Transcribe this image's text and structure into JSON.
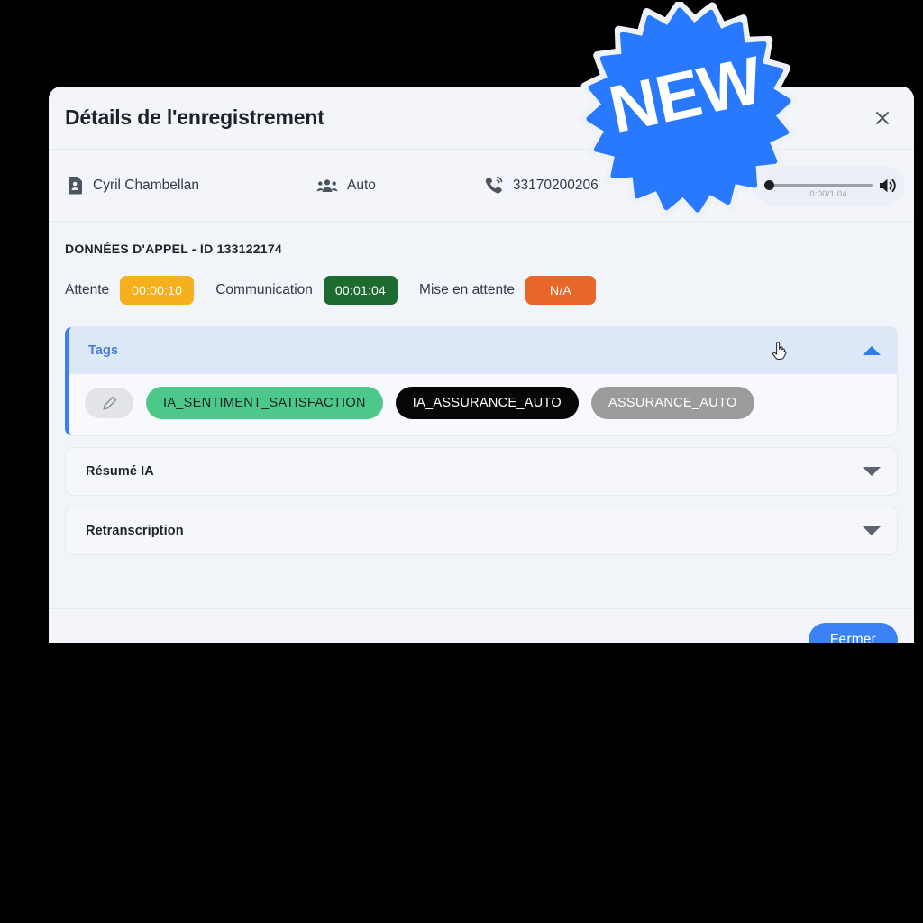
{
  "modal": {
    "title": "Détails de l'enregistrement",
    "close_icon": "close-icon"
  },
  "info_bar": {
    "agent": {
      "icon": "contact-card-icon",
      "label": "Cyril Chambellan"
    },
    "queue": {
      "icon": "group-people-icon",
      "label": "Auto"
    },
    "phone": {
      "icon": "phone-ring-icon",
      "label": "33170200206"
    },
    "audio": {
      "time": "0:00/1:04",
      "progress_percent": 0,
      "volume_icon": "volume-on-icon"
    }
  },
  "call_data": {
    "section_title": "DONNÉES D'APPEL - ID 133122174",
    "metrics": [
      {
        "label": "Attente",
        "value": "00:00:10",
        "color": "#f6b01e"
      },
      {
        "label": "Communication",
        "value": "00:01:04",
        "color": "#1d6b30"
      },
      {
        "label": "Mise en attente",
        "value": "N/A",
        "color": "#e8662a"
      }
    ]
  },
  "accordions": [
    {
      "title": "Tags",
      "expanded": true,
      "caret_icon": "chevron-up-icon",
      "edit_icon": "pencil-icon",
      "tags": [
        {
          "label": "IA_SENTIMENT_SATISFACTION",
          "bg": "#4cc98a",
          "fg": "#1d2329"
        },
        {
          "label": "IA_ASSURANCE_AUTO",
          "bg": "#060606",
          "fg": "#ffffff"
        },
        {
          "label": "ASSURANCE_AUTO",
          "bg": "#9b9b9b",
          "fg": "#ffffff"
        }
      ]
    },
    {
      "title": "Résumé IA",
      "expanded": false,
      "caret_icon": "chevron-down-icon"
    },
    {
      "title": "Retranscription",
      "expanded": false,
      "caret_icon": "chevron-down-icon"
    }
  ],
  "footer": {
    "close_label": "Fermer"
  },
  "badge": {
    "label": "NEW",
    "color": "#2979ff"
  }
}
